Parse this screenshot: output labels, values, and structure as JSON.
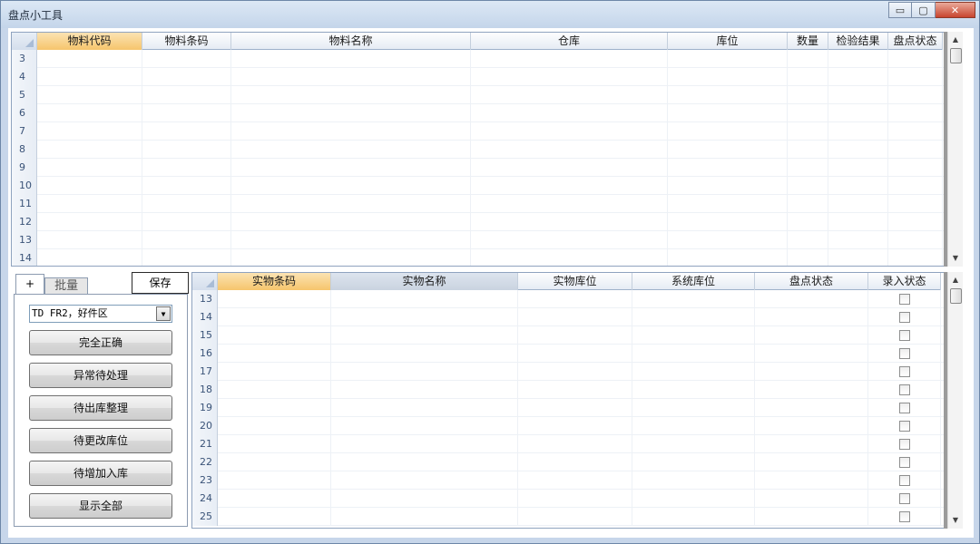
{
  "window": {
    "title": "盘点小工具",
    "minimize": "▭",
    "maximize": "▢",
    "close": "✕"
  },
  "top_grid": {
    "columns": [
      "物料代码",
      "物料条码",
      "物料名称",
      "仓库",
      "库位",
      "数量",
      "检验结果",
      "盘点状态"
    ],
    "row_numbers": [
      "3",
      "4",
      "5",
      "6",
      "7",
      "8",
      "9",
      "10",
      "11",
      "12",
      "13",
      "14"
    ]
  },
  "bottom_grid": {
    "columns": [
      "实物条码",
      "实物名称",
      "实物库位",
      "系统库位",
      "盘点状态",
      "录入状态"
    ],
    "row_numbers": [
      "13",
      "14",
      "15",
      "16",
      "17",
      "18",
      "19",
      "20",
      "21",
      "22",
      "23",
      "24",
      "25"
    ]
  },
  "left_panel": {
    "tabs": [
      "+",
      "批量"
    ],
    "save_label": "保存",
    "location_value": "TD FR2，好件区",
    "actions": [
      "完全正确",
      "异常待处理",
      "待出库整理",
      "待更改库位",
      "待增加入库",
      "显示全部"
    ]
  },
  "scroll": {
    "up": "▲",
    "down": "▼"
  }
}
